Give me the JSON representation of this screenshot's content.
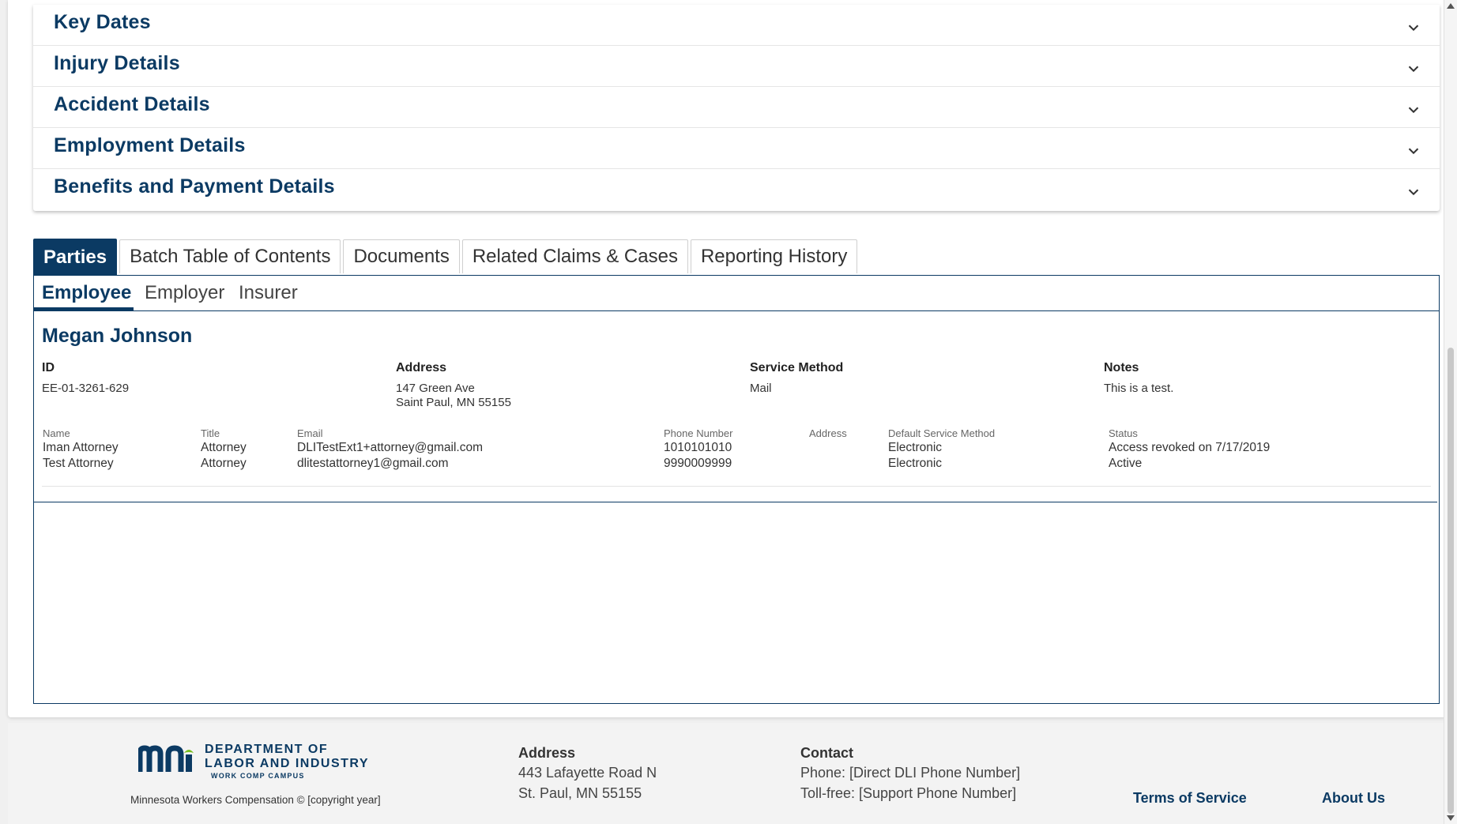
{
  "accordion": {
    "items": [
      {
        "label": "Key Dates"
      },
      {
        "label": "Injury Details"
      },
      {
        "label": "Accident Details"
      },
      {
        "label": "Employment Details"
      },
      {
        "label": "Benefits and Payment Details"
      }
    ]
  },
  "tabs": [
    {
      "label": "Parties",
      "active": true
    },
    {
      "label": "Batch Table of Contents"
    },
    {
      "label": "Documents"
    },
    {
      "label": "Related Claims & Cases"
    },
    {
      "label": "Reporting History"
    }
  ],
  "subtabs": [
    {
      "label": "Employee",
      "active": true
    },
    {
      "label": "Employer"
    },
    {
      "label": "Insurer"
    }
  ],
  "party": {
    "name": "Megan Johnson",
    "id_label": "ID",
    "id_value": "EE-01-3261-629",
    "address_label": "Address",
    "address_line1": "147 Green Ave",
    "address_line2": "Saint Paul, MN 55155",
    "service_label": "Service Method",
    "service_value": "Mail",
    "notes_label": "Notes",
    "notes_value": "This is a test."
  },
  "representatives": {
    "headers": {
      "name": "Name",
      "title": "Title",
      "email": "Email",
      "phone": "Phone Number",
      "address": "Address",
      "service": "Default Service Method",
      "status": "Status"
    },
    "rows": [
      {
        "name": "Iman Attorney",
        "title": "Attorney",
        "email": "DLITestExt1+attorney@gmail.com",
        "phone": "1010101010",
        "address": "",
        "service": "Electronic",
        "status": "Access revoked on 7/17/2019"
      },
      {
        "name": "Test Attorney",
        "title": "Attorney",
        "email": "dlitestattorney1@gmail.com",
        "phone": "9990009999",
        "address": "",
        "service": "Electronic",
        "status": "Active"
      }
    ]
  },
  "footer": {
    "logo_line1": "DEPARTMENT OF",
    "logo_line2": "LABOR AND INDUSTRY",
    "logo_line3": "WORK COMP CAMPUS",
    "copyright": "Minnesota Workers Compensation © [copyright year]",
    "address_label": "Address",
    "address_line1": "443 Lafayette Road N",
    "address_line2": "St. Paul, MN 55155",
    "contact_label": "Contact",
    "phone": "Phone: [Direct DLI Phone Number]",
    "tollfree": "Toll-free: [Support Phone Number]",
    "terms": "Terms of Service",
    "about": "About Us"
  },
  "colors": {
    "brand": "#0b3a63"
  }
}
